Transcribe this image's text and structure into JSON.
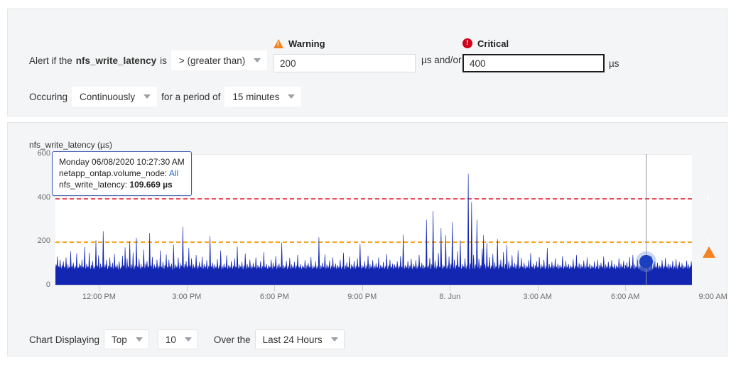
{
  "alert": {
    "prefix": "Alert if the",
    "metric": "nfs_write_latency",
    "is": "is",
    "operator": "> (greater than)",
    "occuring_label": "Occuring",
    "occuring_value": "Continuously",
    "period_label": "for a period of",
    "period_value": "15 minutes",
    "and_or": "µs and/or",
    "warning": {
      "label": "Warning",
      "icon": "warning-triangle-icon",
      "value": "200",
      "unit": "µs",
      "color": "#f58220"
    },
    "critical": {
      "label": "Critical",
      "icon": "critical-circle-icon",
      "value": "400",
      "unit": "µs",
      "color": "#d0021b"
    }
  },
  "chart_panel": {
    "tooltip": {
      "timestamp": "Monday 06/08/2020 10:27:30 AM",
      "dimension_label": "netapp_ontap.volume_node:",
      "dimension_value": "All",
      "metric_label": "nfs_write_latency:",
      "metric_value": "109.669 µs"
    },
    "controls": {
      "displaying_label": "Chart Displaying",
      "rank_value": "Top",
      "count_value": "10",
      "over_label": "Over the",
      "range_value": "Last 24 Hours"
    }
  },
  "chart_data": {
    "type": "area",
    "title": "nfs_write_latency (µs)",
    "xlabel": "",
    "ylabel": "nfs_write_latency (µs)",
    "ylim": [
      0,
      600
    ],
    "yticks": [
      0,
      200,
      400,
      600
    ],
    "xticks": [
      "12:00 PM",
      "3:00 PM",
      "6:00 PM",
      "9:00 PM",
      "8. Jun",
      "3:00 AM",
      "6:00 AM",
      "9:00 AM"
    ],
    "xtick_positions": [
      0.0685,
      0.2063,
      0.3441,
      0.4819,
      0.6197,
      0.7575,
      0.8953,
      1.0331
    ],
    "grid": true,
    "legend": false,
    "series_color": "#1226b2",
    "thresholds": [
      {
        "name": "Critical",
        "value": 400,
        "color": "#e8505b",
        "style": "dashed"
      },
      {
        "name": "Warning",
        "value": 200,
        "color": "#f5a623",
        "style": "dashed"
      }
    ],
    "hover_point": {
      "x_fraction": 0.9275,
      "value": 109.669
    },
    "values": [
      70,
      96,
      78,
      132,
      74,
      88,
      70,
      118,
      84,
      70,
      92,
      76,
      110,
      72,
      86,
      70,
      128,
      80,
      72,
      96,
      70,
      84,
      74,
      156,
      72,
      90,
      70,
      104,
      78,
      70,
      88,
      72,
      146,
      70,
      82,
      76,
      100,
      70,
      92,
      70,
      118,
      74,
      86,
      70,
      176,
      82,
      70,
      98,
      72,
      88,
      70,
      150,
      76,
      70,
      94,
      70,
      112,
      78,
      70,
      86,
      70,
      206,
      74,
      92,
      70,
      138,
      80,
      70,
      100,
      72,
      86,
      70,
      248,
      88,
      72,
      96,
      70,
      118,
      76,
      70,
      90,
      70,
      128,
      74,
      86,
      70,
      104,
      78,
      70,
      144,
      72,
      88,
      70,
      96,
      74,
      70,
      110,
      80,
      70,
      86,
      70,
      136,
      72,
      94,
      70,
      174,
      78,
      70,
      124,
      72,
      88,
      70,
      202,
      80,
      72,
      96,
      70,
      150,
      76,
      70,
      92,
      70,
      218,
      74,
      88,
      70,
      122,
      80,
      70,
      98,
      72,
      86,
      70,
      164,
      84,
      70,
      100,
      74,
      112,
      70,
      88,
      70,
      240,
      78,
      92,
      70,
      130,
      76,
      70,
      96,
      72,
      86,
      70,
      118,
      80,
      70,
      90,
      70,
      160,
      74,
      86,
      70,
      108,
      78,
      70,
      94,
      72,
      142,
      70,
      86,
      70,
      118,
      76,
      90,
      70,
      100,
      72,
      70,
      186,
      82,
      70,
      96,
      74,
      88,
      70,
      128,
      78,
      70,
      104,
      70,
      92,
      72,
      268,
      86,
      70,
      98,
      74,
      110,
      70,
      88,
      70,
      172,
      76,
      92,
      70,
      124,
      80,
      70,
      96,
      70,
      86,
      72,
      140,
      78,
      70,
      92,
      70,
      108,
      74,
      86,
      70,
      130,
      80,
      70,
      98,
      72,
      88,
      70,
      116,
      76,
      70,
      90,
      70,
      226,
      74,
      88,
      70,
      104,
      78,
      70,
      96,
      72,
      86,
      70,
      120,
      80,
      70,
      92,
      70,
      160,
      76,
      70,
      88,
      70,
      100,
      74,
      86,
      70,
      138,
      78,
      70,
      94,
      72,
      86,
      70,
      112,
      80,
      70,
      90,
      70,
      124,
      74,
      86,
      70,
      178,
      82,
      70,
      96,
      70,
      88,
      72,
      108,
      76,
      70,
      92,
      70,
      146,
      78,
      70,
      98,
      72,
      86,
      70,
      118,
      80,
      70,
      90,
      70,
      102,
      74,
      86,
      70,
      128,
      78,
      70,
      94,
      72,
      86,
      70,
      110,
      80,
      70,
      88,
      70,
      152,
      74,
      86,
      70,
      98,
      78,
      70,
      92,
      72,
      86,
      70,
      118,
      80,
      70,
      104,
      70,
      88,
      74,
      134,
      78,
      70,
      92,
      70,
      100,
      72,
      86,
      70,
      196,
      80,
      70,
      94,
      70,
      88,
      72,
      112,
      76,
      70,
      90,
      70,
      126,
      78,
      70,
      96,
      72,
      86,
      70,
      108,
      80,
      70,
      92,
      70,
      140,
      74,
      86,
      70,
      98,
      78,
      70,
      90,
      72,
      86,
      70,
      116,
      80,
      70,
      94,
      70,
      102,
      74,
      86,
      70,
      130,
      78,
      70,
      92,
      72,
      86,
      70,
      110,
      80,
      70,
      88,
      70,
      220,
      76,
      70,
      92,
      70,
      104,
      74,
      86,
      70,
      142,
      80,
      70,
      96,
      72,
      88,
      70,
      114,
      78,
      70,
      90,
      70,
      128,
      74,
      86,
      70,
      100,
      78,
      70,
      94,
      72,
      86,
      70,
      118,
      80,
      70,
      88,
      70,
      150,
      76,
      70,
      92,
      70,
      106,
      74,
      86,
      70,
      132,
      78,
      70,
      96,
      72,
      88,
      70,
      112,
      80,
      70,
      90,
      70,
      124,
      74,
      86,
      70,
      190,
      82,
      70,
      94,
      72,
      86,
      70,
      110,
      78,
      70,
      92,
      70,
      136,
      76,
      70,
      98,
      72,
      88,
      70,
      116,
      80,
      70,
      90,
      70,
      102,
      74,
      86,
      70,
      128,
      78,
      70,
      94,
      72,
      86,
      70,
      108,
      80,
      70,
      88,
      70,
      144,
      76,
      70,
      92,
      70,
      118,
      74,
      86,
      70,
      100,
      78,
      70,
      96,
      72,
      88,
      70,
      110,
      80,
      70,
      90,
      70,
      134,
      74,
      86,
      70,
      232,
      80,
      70,
      94,
      72,
      86,
      70,
      112,
      78,
      70,
      92,
      70,
      122,
      76,
      70,
      98,
      72,
      88,
      70,
      116,
      80,
      70,
      90,
      70,
      140,
      74,
      86,
      70,
      104,
      78,
      70,
      94,
      72,
      86,
      70,
      300,
      88,
      70,
      92,
      70,
      126,
      76,
      70,
      98,
      72,
      340,
      86,
      70,
      114,
      80,
      70,
      90,
      70,
      148,
      74,
      86,
      70,
      262,
      80,
      70,
      96,
      72,
      88,
      70,
      230,
      78,
      70,
      92,
      70,
      132,
      76,
      70,
      100,
      72,
      290,
      86,
      70,
      118,
      80,
      70,
      94,
      70,
      156,
      74,
      86,
      70,
      206,
      78,
      70,
      98,
      72,
      88,
      70,
      124,
      80,
      70,
      92,
      70,
      510,
      76,
      70,
      102,
      74,
      380,
      80,
      70,
      140,
      78,
      70,
      96,
      72,
      300,
      86,
      70,
      122,
      80,
      70,
      94,
      70,
      168,
      74,
      230,
      70,
      100,
      78,
      70,
      196,
      72,
      88,
      70,
      130,
      80,
      70,
      92,
      70,
      144,
      76,
      70,
      106,
      72,
      88,
      70,
      212,
      78,
      70,
      96,
      70,
      118,
      74,
      86,
      70,
      152,
      80,
      70,
      98,
      72,
      186,
      76,
      70,
      110,
      80,
      70,
      92,
      70,
      138,
      74,
      86,
      70,
      102,
      78,
      70,
      96,
      72,
      160,
      80,
      70,
      90,
      70,
      126,
      74,
      86,
      70,
      104,
      78,
      70,
      94,
      72,
      86,
      70,
      116,
      80,
      70,
      148,
      70,
      88,
      74,
      100,
      78,
      70,
      92,
      70,
      110,
      72,
      86,
      70,
      130,
      80,
      70,
      96,
      70,
      88,
      72,
      118,
      76,
      70,
      90,
      70,
      172,
      78,
      70,
      98,
      72,
      86,
      70,
      108,
      80,
      70,
      92,
      70,
      124,
      74,
      86,
      70,
      100,
      78,
      70,
      94,
      72,
      86,
      70,
      134,
      80,
      70,
      88,
      70,
      112,
      74,
      86,
      70,
      98,
      78,
      70,
      92,
      72,
      86,
      70,
      120,
      80,
      70,
      90,
      70,
      140,
      74,
      86,
      70,
      102,
      78,
      70,
      96,
      72,
      88,
      70,
      114,
      80,
      70,
      90,
      70,
      128,
      74,
      86,
      70,
      100,
      78,
      70,
      92,
      72,
      86,
      70,
      110,
      80,
      70,
      88,
      70,
      118,
      76,
      70,
      94,
      70,
      104,
      74,
      86,
      70,
      132,
      78,
      70,
      96,
      72,
      88,
      70,
      108,
      80,
      70,
      90,
      70,
      116,
      74,
      86,
      70,
      98,
      78,
      70,
      92,
      72,
      86,
      70,
      124,
      80,
      70,
      100,
      70,
      88,
      74,
      112,
      78,
      70,
      94,
      70,
      106,
      72,
      86,
      70,
      130,
      80,
      70,
      92,
      70,
      140,
      76,
      70,
      96,
      72,
      88,
      70,
      118,
      80,
      70,
      90,
      70,
      108,
      74,
      86,
      70,
      100,
      78,
      70,
      94,
      72,
      86,
      70,
      122,
      80,
      70,
      88,
      70,
      134,
      76,
      70,
      98,
      70,
      110,
      74,
      86,
      70,
      104,
      78,
      70,
      92,
      72,
      88,
      70,
      116,
      80,
      70,
      90,
      70,
      126,
      74,
      86,
      70,
      100,
      78,
      70,
      96,
      72,
      86,
      70,
      112,
      80,
      70,
      88,
      70,
      120,
      76,
      70,
      94,
      70,
      108,
      74,
      86,
      70,
      102,
      78,
      70,
      92,
      72,
      86,
      70,
      114,
      80,
      70,
      96,
      70,
      88,
      74,
      110,
      78
    ]
  }
}
